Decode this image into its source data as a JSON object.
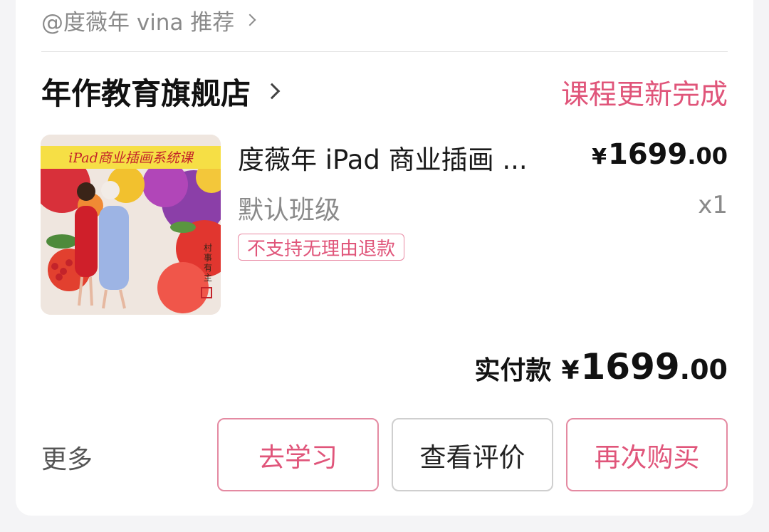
{
  "recommend": {
    "text": "@度薇年 vina 推荐"
  },
  "shop": {
    "name": "年作教育旗舰店",
    "status": "课程更新完成"
  },
  "item": {
    "title": "度薇年 iPad 商业插画 ...",
    "variant": "默认班级",
    "quantity": "x1",
    "price": {
      "currency": "¥",
      "integer": "1699",
      "decimal": ".00"
    },
    "policy_tag": "不支持无理由退款",
    "thumbnail": {
      "banner_text": "iPad商业插画系统课",
      "seal_text": "村事有主"
    }
  },
  "payment": {
    "label": "实付款",
    "currency": "¥",
    "integer": "1699",
    "decimal": ".00"
  },
  "actions": {
    "more": "更多",
    "learn": "去学习",
    "review": "查看评价",
    "rebuy": "再次购买"
  },
  "colors": {
    "accent": "#e0557a",
    "muted": "#8a8a8a",
    "border_gray": "#cfcfcf"
  }
}
